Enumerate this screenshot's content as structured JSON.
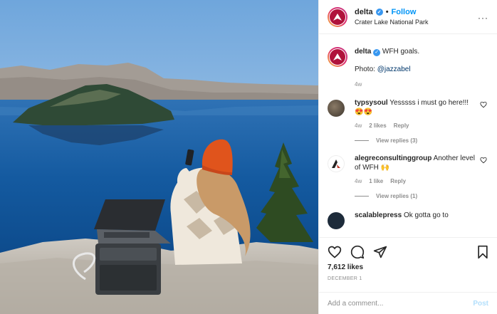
{
  "post_header": {
    "username": "delta",
    "follow_label": "Follow",
    "location": "Crater Lake National Park",
    "separator": "•",
    "more_icon": "more-horizontal-icon",
    "more_label": "···"
  },
  "caption": {
    "username": "delta",
    "text": "WFH goals.",
    "photo_prefix": "Photo: ",
    "mention": "@jazzabel",
    "time": "4w"
  },
  "comments": [
    {
      "username": "typsysoul",
      "text": "Yesssss i must go here!!! 😍😍",
      "time": "4w",
      "likes": "2 likes",
      "reply_label": "Reply",
      "view_replies": "View replies (3)"
    },
    {
      "username": "alegreconsultinggroup",
      "text": "Another level of WFH 🙌",
      "time": "4w",
      "likes": "1 like",
      "reply_label": "Reply",
      "view_replies": "View replies (1)"
    },
    {
      "username": "scalablepress",
      "text": "Ok gotta go to"
    }
  ],
  "actions": {
    "likes": "7,612 likes",
    "date": "DECEMBER 1",
    "comment_placeholder": "Add a comment...",
    "post_label": "Post"
  },
  "colors": {
    "accent": "#0095f6",
    "delta_red": "#b0123b",
    "verified": "#3897f0"
  }
}
